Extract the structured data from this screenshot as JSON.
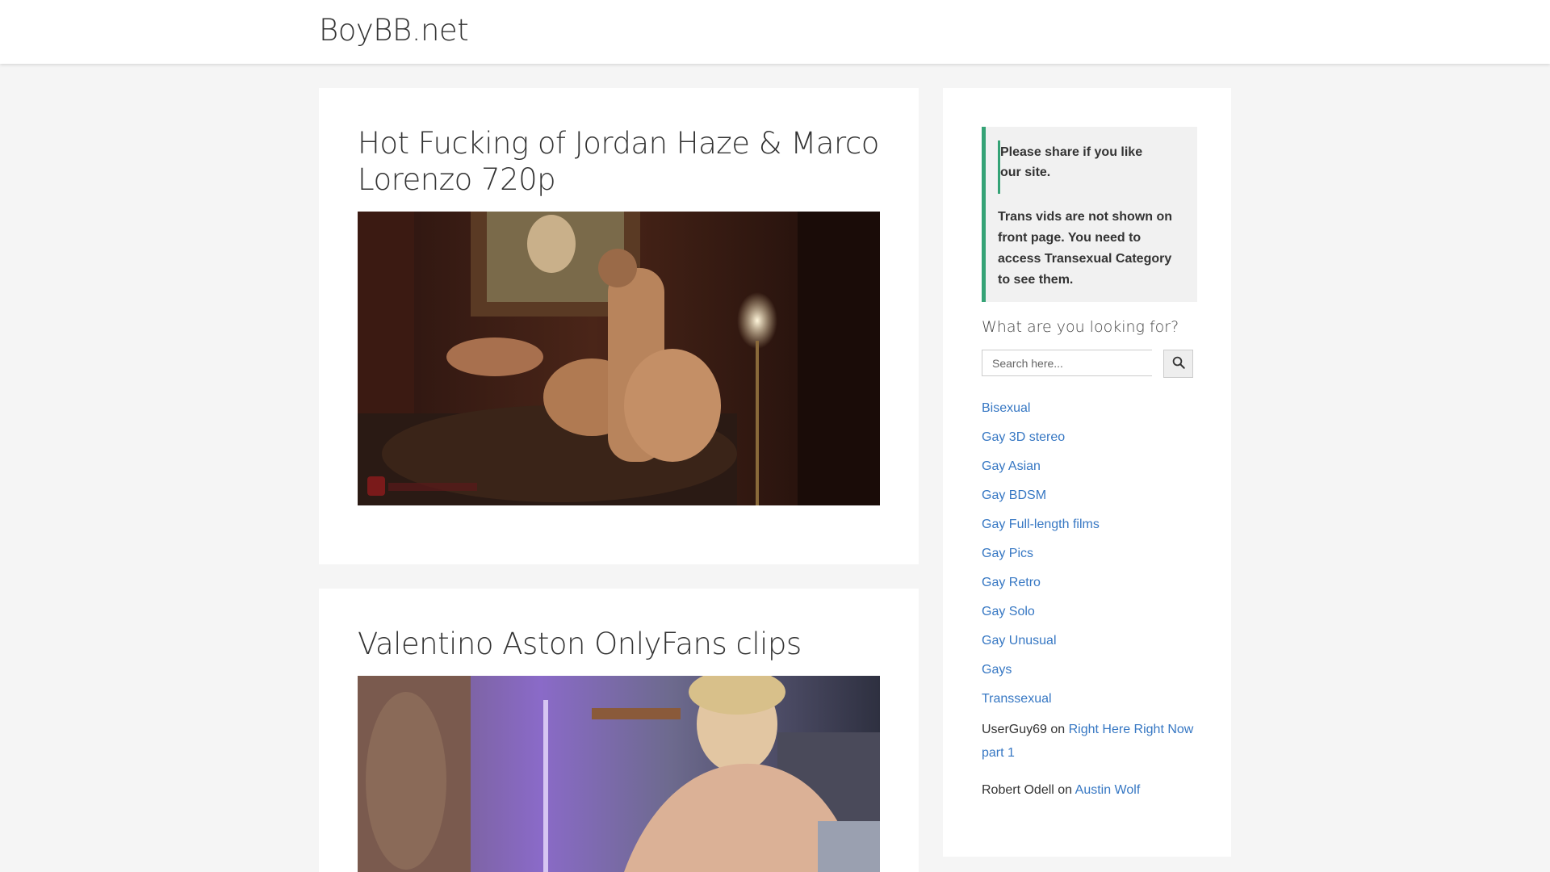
{
  "header": {
    "site_title": "BoyBB.net"
  },
  "posts": [
    {
      "title": "Hot Fucking of Jordan Haze & Marco Lorenzo 720p"
    },
    {
      "title": "Valentino Aston OnlyFans clips"
    }
  ],
  "sidebar": {
    "notice_line1": "Please share if you like our site.",
    "notice_line2": "Trans vids are not shown on front page. You need to access Transexual Category to see them.",
    "search_label": "What are you looking for?",
    "search_placeholder": "Search here...",
    "search_icon": "search-icon",
    "categories": [
      "Bisexual",
      "Gay 3D stereo",
      "Gay Asian",
      "Gay BDSM",
      "Gay Full-length films",
      "Gay Pics",
      "Gay Retro",
      "Gay Solo",
      "Gay Unusual",
      "Gays",
      "Transsexual"
    ],
    "comments": [
      {
        "author": "UserGuy69",
        "on": "on",
        "post": "Right Here Right Now part 1"
      },
      {
        "author": "Robert Odell",
        "on": "on",
        "post": "Austin Wolf"
      }
    ]
  },
  "colors": {
    "accent": "#35a376",
    "link": "#3677c3",
    "background": "#f5f5f5"
  }
}
